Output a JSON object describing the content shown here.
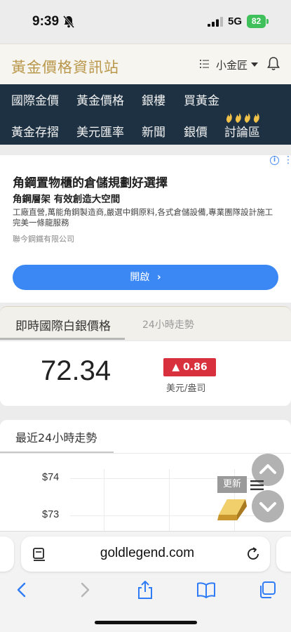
{
  "status_bar": {
    "time": "9:39",
    "network": "5G",
    "battery": "82"
  },
  "header": {
    "site_title": "黃金價格資訊站",
    "user_name": "小金匠"
  },
  "nav": {
    "row1": [
      "國際金價",
      "黃金價格",
      "銀樓",
      "買黃金"
    ],
    "row2": [
      "黃金存摺",
      "美元匯率",
      "新聞",
      "銀價",
      "討論區"
    ]
  },
  "ad": {
    "title": "角鋼置物櫃的倉儲規劃好選擇",
    "subtitle": "角鋼層架 有效創造大空間",
    "description": "工廠直營,萬能角鋼製造商,嚴選中鋼原料,各式倉儲設備,專業團隊設計施工完美一條龍服務",
    "company": "聯今鋼鐵有限公司",
    "button_label": "開啟"
  },
  "price": {
    "tab_live": "即時國際白銀價格",
    "tab_24h": "24小時走勢",
    "value": "72.34",
    "change": "▲ 0.86",
    "unit": "美元/盎司",
    "change_color": "#d9303d"
  },
  "trend": {
    "title": "最近24小時走勢",
    "y_ticks": [
      "$74",
      "$73"
    ]
  },
  "floating": {
    "refresh_label": "更新"
  },
  "browser": {
    "url": "goldlegend.com"
  }
}
